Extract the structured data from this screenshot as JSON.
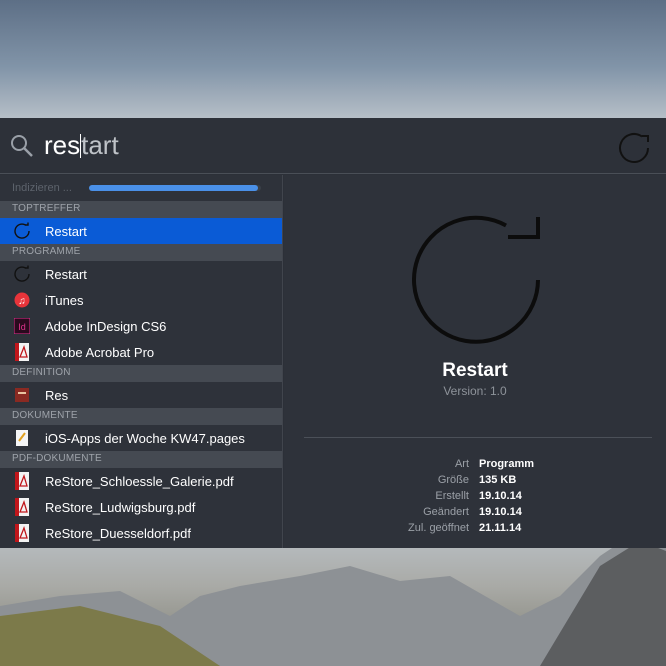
{
  "search": {
    "query_typed": "res",
    "query_completion": "tart"
  },
  "status": {
    "text": "Indizieren ...",
    "progress": 0.98
  },
  "sections": [
    {
      "title": "TOPTREFFER",
      "items": [
        {
          "label": "Restart",
          "icon": "restart-icon",
          "selected": true
        }
      ]
    },
    {
      "title": "PROGRAMME",
      "items": [
        {
          "label": "Restart",
          "icon": "restart-icon"
        },
        {
          "label": "iTunes",
          "icon": "itunes-icon"
        },
        {
          "label": "Adobe InDesign CS6",
          "icon": "indesign-icon"
        },
        {
          "label": "Adobe Acrobat Pro",
          "icon": "acrobat-icon"
        }
      ]
    },
    {
      "title": "DEFINITION",
      "items": [
        {
          "label": "Res",
          "icon": "dictionary-icon"
        }
      ]
    },
    {
      "title": "DOKUMENTE",
      "items": [
        {
          "label": "iOS-Apps der Woche KW47.pages",
          "icon": "pages-icon"
        }
      ]
    },
    {
      "title": "PDF-DOKUMENTE",
      "items": [
        {
          "label": "ReStore_Schloessle_Galerie.pdf",
          "icon": "pdf-icon"
        },
        {
          "label": "ReStore_Ludwigsburg.pdf",
          "icon": "pdf-icon"
        },
        {
          "label": "ReStore_Duesseldorf.pdf",
          "icon": "pdf-icon"
        }
      ]
    }
  ],
  "preview": {
    "name": "Restart",
    "version": "Version: 1.0",
    "meta": [
      {
        "k": "Art",
        "v": "Programm"
      },
      {
        "k": "Größe",
        "v": "135 KB"
      },
      {
        "k": "Erstellt",
        "v": "19.10.14"
      },
      {
        "k": "Geändert",
        "v": "19.10.14"
      },
      {
        "k": "Zul. geöffnet",
        "v": "21.11.14"
      }
    ]
  },
  "colors": {
    "selection": "#0a5bd6",
    "progress": "#4a90e8"
  }
}
